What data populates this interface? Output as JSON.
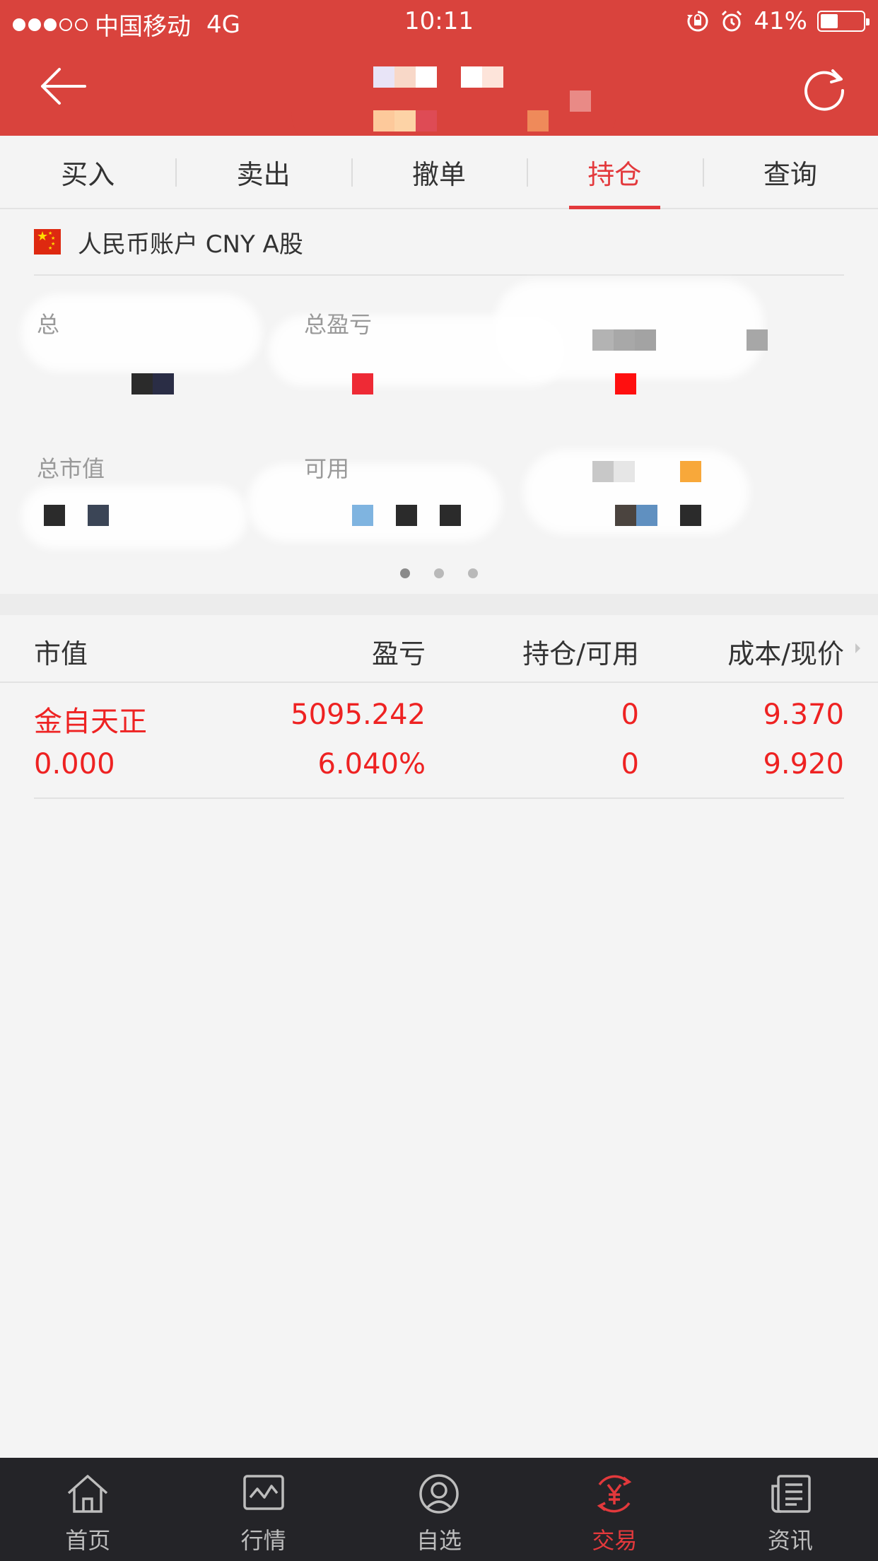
{
  "status_bar": {
    "carrier": "中国移动",
    "network": "4G",
    "time": "10:11",
    "battery_percent": "41%",
    "battery_level": 0.41,
    "signal_bars_filled": 3,
    "signal_bars_total": 5
  },
  "header": {
    "back_icon": "arrow-left-icon",
    "refresh_icon": "refresh-icon"
  },
  "tabs": [
    {
      "label": "买入",
      "active": false
    },
    {
      "label": "卖出",
      "active": false
    },
    {
      "label": "撤单",
      "active": false
    },
    {
      "label": "持仓",
      "active": true
    },
    {
      "label": "查询",
      "active": false
    }
  ],
  "account": {
    "label": "人民币账户 CNY A股",
    "flag_icon": "china-flag-icon",
    "stats": {
      "total_pnl_label": "总盈亏",
      "market_value_label": "总市值",
      "available_label": "可用"
    },
    "page_count": 3,
    "active_page": 0
  },
  "table": {
    "headers": [
      "市值",
      "盈亏",
      "持仓/可用",
      "成本/现价"
    ],
    "rows": [
      {
        "name": "金自天正",
        "market_value": "0.000",
        "pnl": "5095.242",
        "pnl_percent": "6.040%",
        "position": "0",
        "available": "0",
        "cost": "9.370",
        "price": "9.920"
      }
    ]
  },
  "bottom_nav": [
    {
      "label": "首页",
      "icon": "home-icon",
      "active": false
    },
    {
      "label": "行情",
      "icon": "chart-icon",
      "active": false
    },
    {
      "label": "自选",
      "icon": "user-circle-icon",
      "active": false
    },
    {
      "label": "交易",
      "icon": "yuan-exchange-icon",
      "active": true
    },
    {
      "label": "资讯",
      "icon": "news-icon",
      "active": false
    }
  ],
  "colors": {
    "brand_red": "#d9433d",
    "active_red": "#e3393c",
    "value_red": "#ee2222",
    "nav_bg": "#242428"
  }
}
